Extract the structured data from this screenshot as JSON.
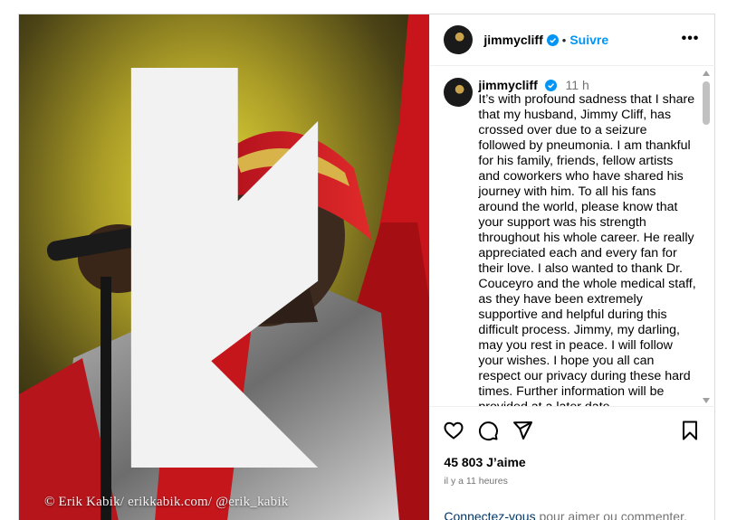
{
  "photo": {
    "credit": "© Erik Kabik/ erikkabik.com/ @erik_kabik"
  },
  "header": {
    "username": "jimmycliff",
    "separator": "•",
    "follow_label": "Suivre",
    "more_label": "•••"
  },
  "caption": {
    "username": "jimmycliff",
    "time": "11 h",
    "text": "It’s with profound sadness that I share that my husband, Jimmy Cliff, has crossed over due to a seizure followed by pneumonia. I am thankful for his family, friends, fellow artists and coworkers who have shared his journey with him. To all his fans around the world, please know that your support was his strength throughout his whole career. He really appreciated each and every fan for their love. I also wanted to thank Dr. Couceyro and the whole medical staff, as they have been extremely supportive and helpful during this difficult process. Jimmy, my darling, may you rest in peace. I will follow your wishes. I hope you all can respect our privacy during these hard times. Further information will be provided at a later date.\nSee you and we see you Legend."
  },
  "actions": {
    "likes": "45 803 J’aime",
    "posted": "il y a 11 heures",
    "login_link": "Connectez-vous",
    "login_rest": " pour aimer ou commenter."
  },
  "colors": {
    "accent": "#0095f6",
    "verified": "#0095f6",
    "link": "#00376b",
    "muted": "#737373"
  },
  "icons": [
    "verified-badge-icon",
    "more-options-icon",
    "heart-icon",
    "comment-icon",
    "share-icon",
    "bookmark-icon"
  ]
}
